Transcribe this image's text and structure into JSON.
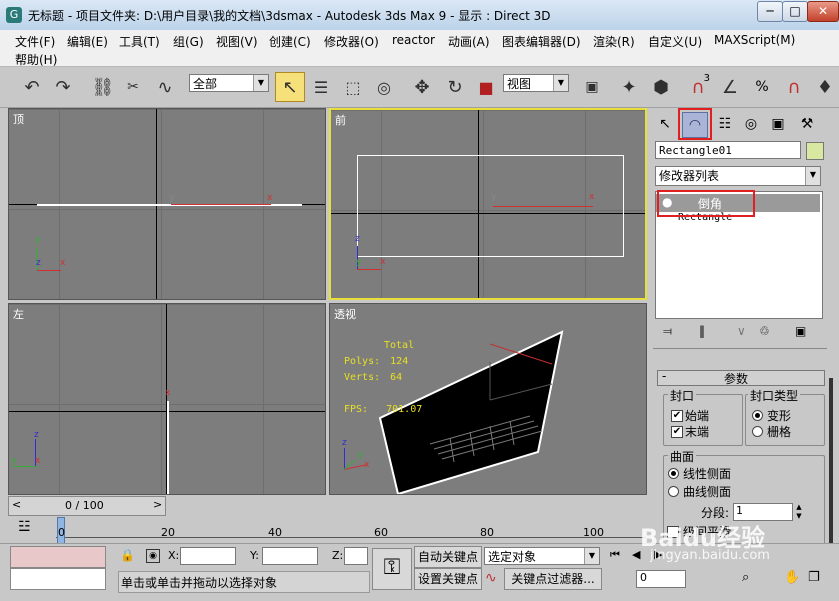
{
  "window": {
    "icon": "3dsmax-app-icon",
    "title": "无标题    - 项目文件夹: D:\\用户目录\\我的文档\\3dsmax    - Autodesk 3ds Max 9    - 显示 : Direct 3D",
    "minimize": "─",
    "maximize": "□",
    "close": "✕"
  },
  "menu": {
    "items": [
      "文件(F)",
      "编辑(E)",
      "工具(T)",
      "组(G)",
      "视图(V)",
      "创建(C)",
      "修改器(O)",
      "reactor",
      "动画(A)",
      "图表编辑器(D)",
      "渲染(R)",
      "自定义(U)",
      "MAXScript(M)",
      "帮助(H)"
    ]
  },
  "toolbar": {
    "undo_icon": "undo-icon",
    "redo_icon": "redo-icon",
    "selection_filter": "全部",
    "ref_coord": "视图",
    "snap_badge": "3",
    "angle_snap_label": "%"
  },
  "viewports": {
    "top": {
      "label": "顶"
    },
    "front": {
      "label": "前"
    },
    "left": {
      "label": "左"
    },
    "perspective": {
      "label": "透视",
      "stats_total": "Total",
      "polys_label": "Polys:",
      "polys_value": "124",
      "verts_label": "Verts:",
      "verts_value": "64",
      "fps_label": "FPS:",
      "fps_value": "701.07"
    },
    "axis_x": "x",
    "axis_y": "y",
    "axis_z": "z"
  },
  "command_panel": {
    "object_name": "Rectangle01",
    "object_color": "#d8e8a0",
    "modifier_list": "修改器列表",
    "stack_items": [
      "倒角",
      "Rectangle"
    ],
    "params_title": "参数",
    "caps_title": "封口",
    "cap_start": "始端",
    "cap_end": "末端",
    "cap_type_title": "封口类型",
    "cap_morph": "变形",
    "cap_grid": "栅格",
    "surface_title": "曲面",
    "linear_sides": "线性侧面",
    "curved_sides": "曲线侧面",
    "segments_label": "分段:",
    "segments_value": "1",
    "level_label": "级间平滑"
  },
  "timeline": {
    "frame_display": "0 / 100",
    "prev": "<",
    "next": ">",
    "ticks": [
      "0",
      "20",
      "40",
      "60",
      "80",
      "100"
    ]
  },
  "status": {
    "x_label": "X:",
    "y_label": "Y:",
    "z_label": "Z:",
    "auto_key": "自动关键点",
    "set_key": "设置关键点",
    "key_filter": "关键点过滤器...",
    "selected_object": "选定对象",
    "frame_value": "0",
    "prompt": "单击或单击并拖动以选择对象",
    "watermark": "Baidu经验",
    "watermark_url": "jingyan.baidu.com"
  },
  "colors": {
    "active_viewport_border": "#e8e038",
    "highlight_box": "#e02020",
    "x_axis": "#d03030",
    "y_axis": "#30b030",
    "z_axis": "#3030d0",
    "stats_text": "#e8e020"
  }
}
